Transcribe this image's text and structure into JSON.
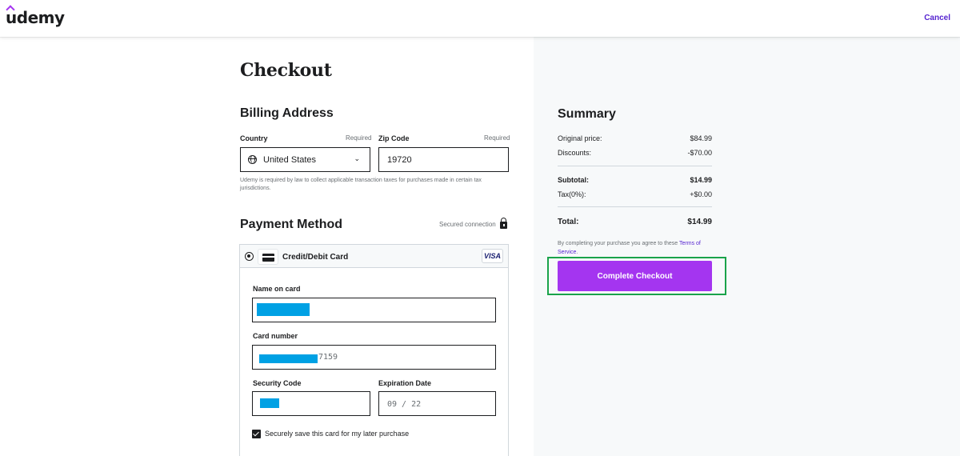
{
  "header": {
    "logo": "udemy",
    "cancel_label": "Cancel"
  },
  "colors": {
    "brand_purple": "#a435f0",
    "link_purple": "#5624d0",
    "highlight_green": "#1aa34a",
    "mask_blue": "#00a1e4"
  },
  "checkout": {
    "title": "Checkout",
    "billing": {
      "heading": "Billing Address",
      "country_label": "Country",
      "country_required": "Required",
      "country_value": "United States",
      "zip_label": "Zip Code",
      "zip_required": "Required",
      "zip_value": "19720",
      "tax_note": "Udemy is required by law to collect applicable transaction taxes for purchases made in certain tax jurisdictions."
    },
    "payment": {
      "heading": "Payment Method",
      "secured_text": "Secured connection",
      "method_label": "Credit/Debit Card",
      "card_brand": "VISA",
      "name_label": "Name on card",
      "card_number_label": "Card number",
      "card_number_suffix": "7159",
      "security_code_label": "Security Code",
      "expiration_label": "Expiration Date",
      "expiration_value": "09 / 22",
      "save_card_label": "Securely save this card for my later purchase",
      "save_card_checked": true
    }
  },
  "summary": {
    "title": "Summary",
    "original_price_label": "Original price:",
    "original_price": "$84.99",
    "discounts_label": "Discounts:",
    "discounts": "-$70.00",
    "subtotal_label": "Subtotal:",
    "subtotal": "$14.99",
    "tax_label": "Tax(0%):",
    "tax": "+$0.00",
    "total_label": "Total:",
    "total": "$14.99",
    "terms_prefix": "By completing your purchase you agree to these ",
    "terms_link": "Terms of Service",
    "terms_suffix": ".",
    "cta_label": "Complete Checkout"
  }
}
